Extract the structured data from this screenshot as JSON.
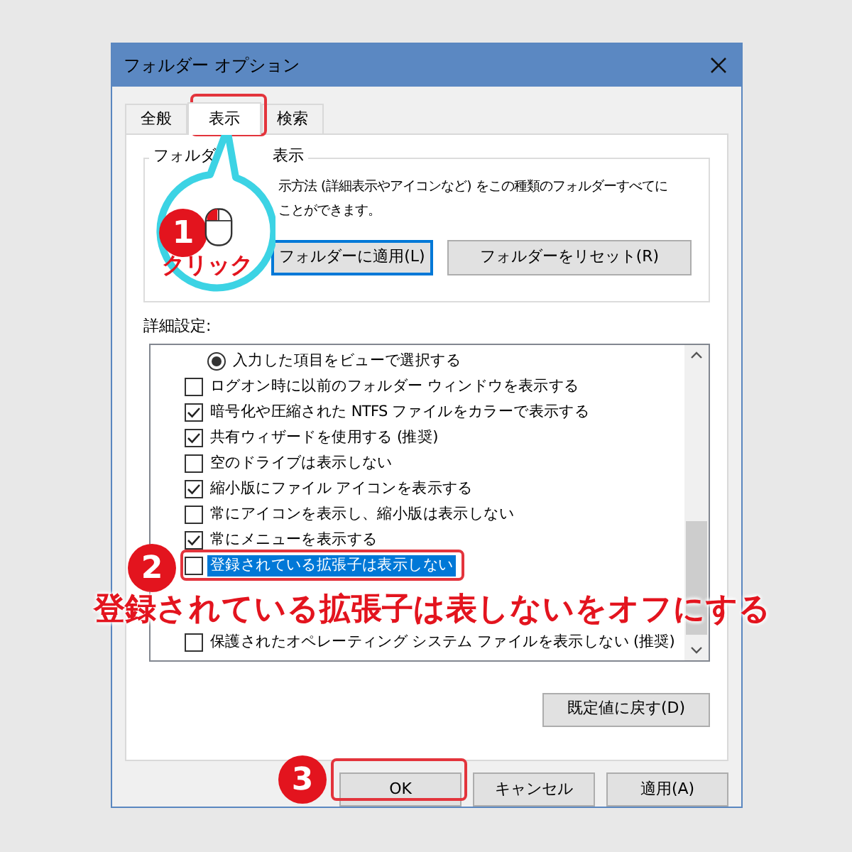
{
  "window": {
    "title": "フォルダー オプション"
  },
  "tabs": [
    {
      "label": "全般",
      "selected": false
    },
    {
      "label": "表示",
      "selected": true
    },
    {
      "label": "検索",
      "selected": false
    }
  ],
  "folder_view": {
    "title_parts": [
      "フォルダ",
      "表示"
    ],
    "description": [
      "示方法 (詳細表示やアイコンなど) をこの種類のフォルダーすべてに",
      "ことができます。"
    ],
    "buttons": [
      "フォルダーに適用(L)",
      "フォルダーをリセット(R)"
    ]
  },
  "advanced": {
    "label": "詳細設定:",
    "items": [
      {
        "kind": "radio",
        "label": "入力した項目をビューで選択する",
        "checked": true,
        "selected": false
      },
      {
        "kind": "checkbox",
        "label": "ログオン時に以前のフォルダー ウィンドウを表示する",
        "checked": false,
        "selected": false
      },
      {
        "kind": "checkbox",
        "label": "暗号化や圧縮された NTFS ファイルをカラーで表示する",
        "checked": true,
        "selected": false
      },
      {
        "kind": "checkbox",
        "label": "共有ウィザードを使用する (推奨)",
        "checked": true,
        "selected": false
      },
      {
        "kind": "checkbox",
        "label": "空のドライブは表示しない",
        "checked": false,
        "selected": false
      },
      {
        "kind": "checkbox",
        "label": "縮小版にファイル アイコンを表示する",
        "checked": true,
        "selected": false
      },
      {
        "kind": "checkbox",
        "label": "常にアイコンを表示し、縮小版は表示しない",
        "checked": false,
        "selected": false
      },
      {
        "kind": "checkbox",
        "label": "常にメニューを表示する",
        "checked": true,
        "selected": false
      },
      {
        "kind": "checkbox",
        "label": "登録されている拡張子は表示しない",
        "checked": false,
        "selected": true
      },
      {
        "kind": "checkbox",
        "label": "保護されたオペレーティング システム ファイルを表示しない (推奨)",
        "checked": false,
        "selected": false
      }
    ],
    "reset_button": "既定値に戻す(D)"
  },
  "buttons": [
    "OK",
    "キャンセル",
    "適用(A)"
  ],
  "annotations": {
    "step1": {
      "number": "1",
      "label": "クリック"
    },
    "step2": {
      "number": "2",
      "note": "登録されている拡張子は表しないをオフにする"
    },
    "step3": {
      "number": "3"
    }
  }
}
